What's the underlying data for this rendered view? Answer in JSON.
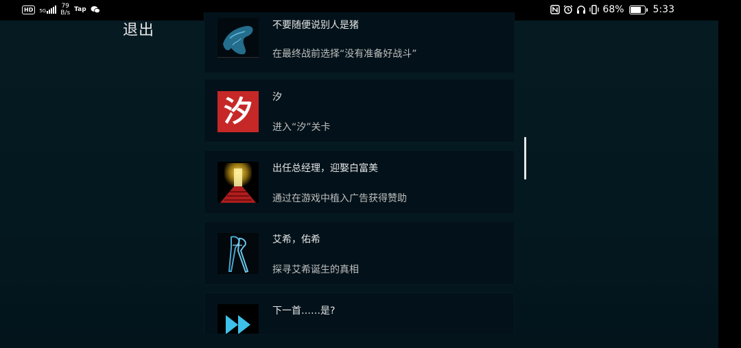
{
  "status_bar": {
    "hd_badge": "HD",
    "network": "5G",
    "speed_value": "79",
    "speed_unit": "B/s",
    "tap_label": "Tap",
    "battery_percent": "68%",
    "battery_level": 0.68,
    "time": "5:33",
    "icons": [
      "nfc-icon",
      "alarm-icon",
      "headphones-icon",
      "vibrate-icon",
      "battery-icon"
    ]
  },
  "exit_label": "退出",
  "achievements": [
    {
      "title": "不要随便说别人是猪",
      "desc": "在最终战前选择“没有准备好战斗”",
      "icon": "blue-creature-icon"
    },
    {
      "title": "汐",
      "desc": "进入“汐”关卡",
      "icon_char": "汐",
      "icon": "xi-character-icon"
    },
    {
      "title": "出任总经理，迎娶白富美",
      "desc": "通过在游戏中植入广告获得赞助",
      "icon": "golden-door-icon"
    },
    {
      "title": "艾希，佑希",
      "desc": "探寻艾希诞生的真相",
      "icon": "twin-blades-icon"
    },
    {
      "title": "下一首……是?",
      "desc": "",
      "icon": "fast-forward-icon"
    }
  ],
  "colors": {
    "background": "#051820",
    "card": "#03121a",
    "accent_red": "#c62828",
    "accent_blue": "#3ec1e8"
  }
}
